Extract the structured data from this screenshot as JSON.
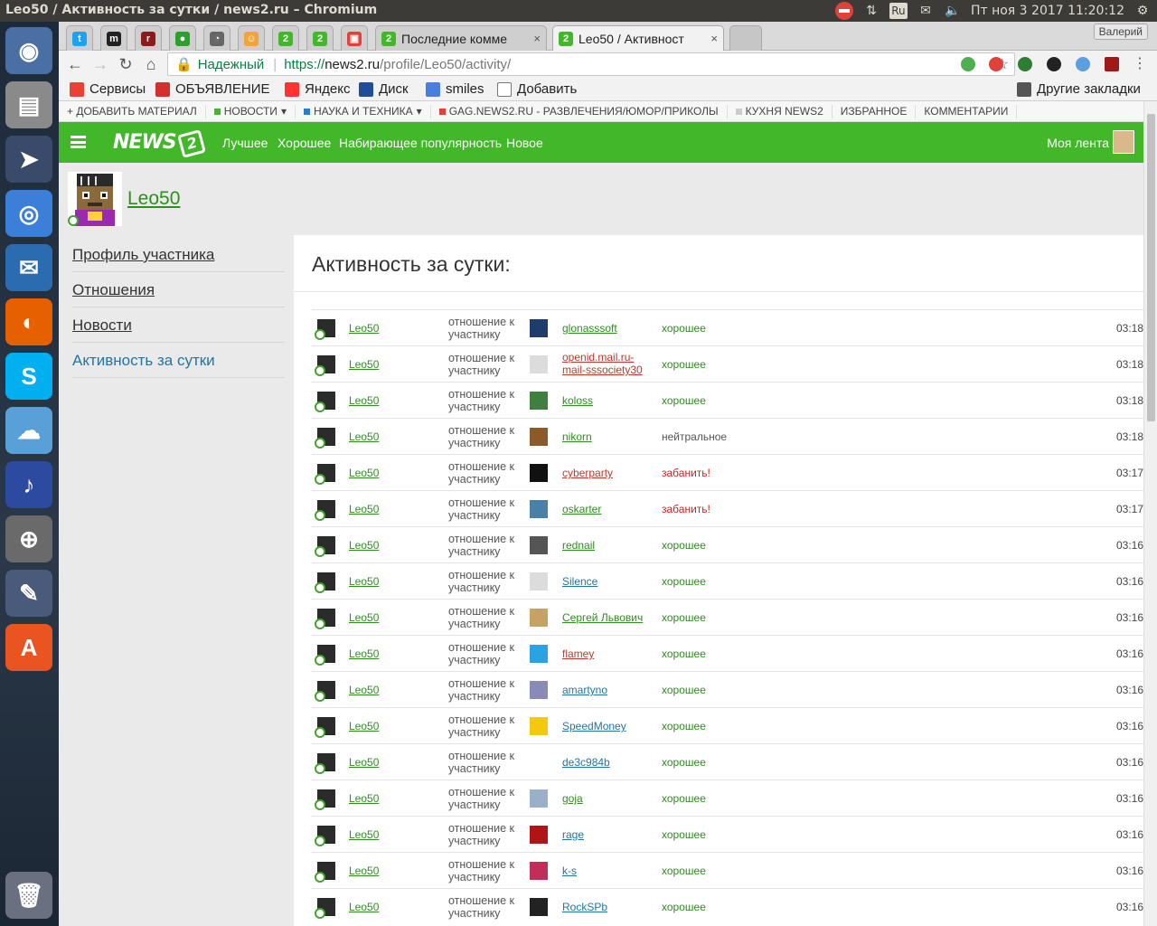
{
  "window": {
    "title": "Leo50 / Активность за сутки / news2.ru – Chromium"
  },
  "system": {
    "keyboard": "Ru",
    "datetime": "Пт ноя  3 2017 11:20:12"
  },
  "tabs": [
    {
      "label": "",
      "color": "#1da1f2",
      "glyph": "t"
    },
    {
      "label": "",
      "color": "#222222",
      "glyph": "m"
    },
    {
      "label": "",
      "color": "#8b1a1a",
      "glyph": "r"
    },
    {
      "label": "",
      "color": "#2ca02c",
      "glyph": "●"
    },
    {
      "label": "",
      "color": "#666666",
      "glyph": "◔"
    },
    {
      "label": "",
      "color": "#f2a33a",
      "glyph": "☺"
    },
    {
      "label": "",
      "color": "#42b72a",
      "glyph": "2"
    },
    {
      "label": "",
      "color": "#42b72a",
      "glyph": "2"
    },
    {
      "label": "",
      "color": "#e0413a",
      "glyph": "▣"
    },
    {
      "label": "Последние комме",
      "color": "#42b72a",
      "glyph": "2"
    },
    {
      "label": "Leo50 / Активност",
      "color": "#42b72a",
      "glyph": "2"
    }
  ],
  "profile_user": "Валерий",
  "address": {
    "secure_label": "Надежный",
    "scheme": "https://",
    "host": "news2.ru",
    "path": "/profile/Leo50/activity/"
  },
  "bookmarks": [
    {
      "label": "Сервисы",
      "color": "#e94235"
    },
    {
      "label": "ОБЪЯВЛЕНИЕ",
      "color": "#d22f2f"
    },
    {
      "label": "Яндекс",
      "color": "#ff3333"
    },
    {
      "label": "Диск",
      "color": "#1f4c9b"
    },
    {
      "label": "smiles",
      "color": "#4a7de0"
    },
    {
      "label": "Добавить",
      "color": "#ffffff"
    }
  ],
  "other_bookmarks": "Другие закладки",
  "site_nav": [
    {
      "label": "+ ДОБАВИТЬ МАТЕРИАЛ",
      "dot": "",
      "arrow": ""
    },
    {
      "label": "НОВОСТИ",
      "dot": "#42b72a",
      "arrow": "▾"
    },
    {
      "label": "НАУКА И ТЕХНИКА",
      "dot": "#2a7fc9",
      "arrow": "▾"
    },
    {
      "label": "GAG.NEWS2.RU - РАЗВЛЕЧЕНИЯ/ЮМОР/ПРИКОЛЫ",
      "dot": "#e0413a",
      "arrow": ""
    },
    {
      "label": "КУХНЯ NEWS2",
      "dot": "#cccccc",
      "arrow": ""
    },
    {
      "label": "ИЗБРАННОЕ",
      "dot": "",
      "arrow": ""
    },
    {
      "label": "КОММЕНТАРИИ",
      "dot": "",
      "arrow": ""
    }
  ],
  "header": {
    "logo": "NEWS",
    "logo_badge": "2",
    "nav": [
      "Лучшее",
      "Хорошее",
      "Набирающее популярность",
      "Новое"
    ],
    "feed": "Моя лента"
  },
  "user": {
    "name": "Leo50"
  },
  "side_menu": [
    "Профиль участника",
    "Отношения",
    "Новости",
    "Активность за сутки"
  ],
  "page_title": "Активность за сутки:",
  "relation_label": "отношение к участнику",
  "activity": [
    {
      "actor": "Leo50",
      "target": "glonasssoft",
      "value": "хорошее",
      "time": "03:18",
      "tcolor": "#2d8f1c",
      "vcolor": "#2d8f1c",
      "avatar": "#1f3d6b"
    },
    {
      "actor": "Leo50",
      "target": "openid.mail.ru-mail-sssociety30",
      "value": "хорошее",
      "time": "03:18",
      "tcolor": "#c0392b",
      "vcolor": "#2d8f1c",
      "avatar": "#dcdcdc"
    },
    {
      "actor": "Leo50",
      "target": "koloss",
      "value": "хорошее",
      "time": "03:18",
      "tcolor": "#2d8f1c",
      "vcolor": "#2d8f1c",
      "avatar": "#3f7f3f"
    },
    {
      "actor": "Leo50",
      "target": "nikorn",
      "value": "нейтральное",
      "time": "03:18",
      "tcolor": "#2d8f1c",
      "vcolor": "#555555",
      "avatar": "#8a5a2b"
    },
    {
      "actor": "Leo50",
      "target": "cyberparty",
      "value": "забанить!",
      "time": "03:17",
      "tcolor": "#c0392b",
      "vcolor": "#d42020",
      "avatar": "#111111"
    },
    {
      "actor": "Leo50",
      "target": "oskarter",
      "value": "забанить!",
      "time": "03:17",
      "tcolor": "#2d8f1c",
      "vcolor": "#d42020",
      "avatar": "#4a7fa8"
    },
    {
      "actor": "Leo50",
      "target": "rednail",
      "value": "хорошее",
      "time": "03:16",
      "tcolor": "#2d8f1c",
      "vcolor": "#2d8f1c",
      "avatar": "#555555"
    },
    {
      "actor": "Leo50",
      "target": "Silence",
      "value": "хорошее",
      "time": "03:16",
      "tcolor": "#2175a8",
      "vcolor": "#2d8f1c",
      "avatar": "#dcdcdc"
    },
    {
      "actor": "Leo50",
      "target": "Сергей Львович",
      "value": "хорошее",
      "time": "03:16",
      "tcolor": "#2d8f1c",
      "vcolor": "#2d8f1c",
      "avatar": "#c8a165"
    },
    {
      "actor": "Leo50",
      "target": "flamey",
      "value": "хорошее",
      "time": "03:16",
      "tcolor": "#c0392b",
      "vcolor": "#2d8f1c",
      "avatar": "#2aa3e0"
    },
    {
      "actor": "Leo50",
      "target": "amartyno",
      "value": "хорошее",
      "time": "03:16",
      "tcolor": "#2175a8",
      "vcolor": "#2d8f1c",
      "avatar": "#8a8ab8"
    },
    {
      "actor": "Leo50",
      "target": "SpeedMoney",
      "value": "хорошее",
      "time": "03:16",
      "tcolor": "#2175a8",
      "vcolor": "#2d8f1c",
      "avatar": "#f2c811"
    },
    {
      "actor": "Leo50",
      "target": "de3c984b",
      "value": "хорошее",
      "time": "03:16",
      "tcolor": "#2175a8",
      "vcolor": "#2d8f1c",
      "avatar": "#ffffff"
    },
    {
      "actor": "Leo50",
      "target": "goja",
      "value": "хорошее",
      "time": "03:16",
      "tcolor": "#2d8f1c",
      "vcolor": "#2d8f1c",
      "avatar": "#9ab0c8"
    },
    {
      "actor": "Leo50",
      "target": "rage",
      "value": "хорошее",
      "time": "03:16",
      "tcolor": "#2175a8",
      "vcolor": "#2d8f1c",
      "avatar": "#b01515"
    },
    {
      "actor": "Leo50",
      "target": "k-s",
      "value": "хорошее",
      "time": "03:16",
      "tcolor": "#2175a8",
      "vcolor": "#2d8f1c",
      "avatar": "#c02f5a"
    },
    {
      "actor": "Leo50",
      "target": "RockSPb",
      "value": "хорошее",
      "time": "03:16",
      "tcolor": "#2175a8",
      "vcolor": "#2d8f1c",
      "avatar": "#222222"
    }
  ]
}
